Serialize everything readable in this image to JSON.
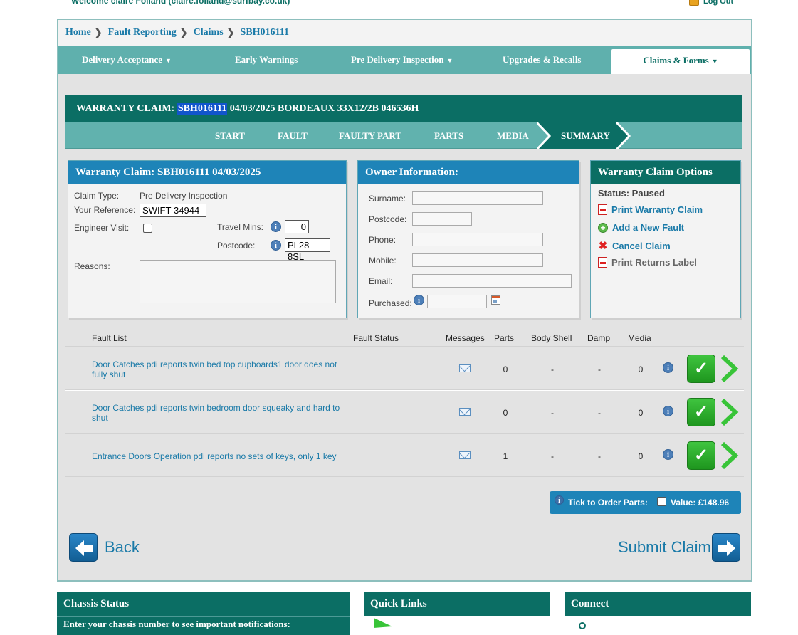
{
  "header": {
    "welcome": "Welcome claire Folland (claire.folland@surfbay.co.uk)",
    "logout": "Log Out"
  },
  "breadcrumb": [
    "Home",
    "Fault Reporting",
    "Claims",
    "SBH016111"
  ],
  "nav": {
    "items": [
      "Delivery Acceptance",
      "Early Warnings",
      "Pre Delivery Inspection",
      "Upgrades & Recalls",
      "Claims & Forms"
    ],
    "active": "Claims & Forms"
  },
  "claim_header": {
    "prefix": "WARRANTY CLAIM:",
    "claim_no": "SBH016111",
    "rest": "04/03/2025 BORDEAUX 33X12/2B 046536H"
  },
  "steps": [
    "START",
    "FAULT",
    "FAULTY PART",
    "PARTS",
    "MEDIA",
    "SUMMARY"
  ],
  "claim_panel": {
    "title": "Warranty Claim: SBH016111 04/03/2025",
    "claim_type_label": "Claim Type:",
    "claim_type_value": "Pre Delivery Inspection",
    "your_ref_label": "Your Reference:",
    "your_ref_value": "SWIFT-34944",
    "engineer_visit_label": "Engineer Visit:",
    "travel_mins_label": "Travel Mins:",
    "travel_mins_value": "0",
    "postcode_label": "Postcode:",
    "postcode_value": "PL28 8SL",
    "reasons_label": "Reasons:"
  },
  "owner_panel": {
    "title": "Owner Information:",
    "surname_label": "Surname:",
    "postcode_label": "Postcode:",
    "phone_label": "Phone:",
    "mobile_label": "Mobile:",
    "email_label": "Email:",
    "purchased_label": "Purchased:"
  },
  "options_panel": {
    "title": "Warranty Claim Options",
    "status": "Status: Paused",
    "print": "Print Warranty Claim",
    "add_fault": "Add a New Fault",
    "cancel": "Cancel Claim",
    "returns": "Print Returns Label"
  },
  "fault_list": {
    "headers": [
      "Fault List",
      "Fault Status",
      "Messages",
      "Parts",
      "Body Shell",
      "Damp",
      "Media"
    ],
    "rows": [
      {
        "text": "Door Catches pdi reports twin bed top cupboards1 door does not fully shut",
        "parts": "0",
        "body_shell": "-",
        "damp": "-",
        "media": "0"
      },
      {
        "text": "Door Catches pdi reports twin bedroom door squeaky and hard to shut",
        "parts": "0",
        "body_shell": "-",
        "damp": "-",
        "media": "0"
      },
      {
        "text": "Entrance Doors Operation pdi reports no sets of keys, only 1 key",
        "parts": "1",
        "body_shell": "-",
        "damp": "-",
        "media": "0"
      }
    ]
  },
  "order": {
    "tick_label": "Tick to Order Parts:",
    "value_label": "Value: £148.96"
  },
  "actions": {
    "back": "Back",
    "submit": "Submit Claim"
  },
  "bottom": {
    "chassis_title": "Chassis Status",
    "chassis_text": "Enter your chassis number to see important notifications:",
    "quick_links": "Quick Links",
    "connect": "Connect"
  },
  "colors": {
    "dark_green": "#0b6e64",
    "teal": "#5fb0ad",
    "blue": "#1e84b8",
    "link": "#1a7aa8"
  }
}
